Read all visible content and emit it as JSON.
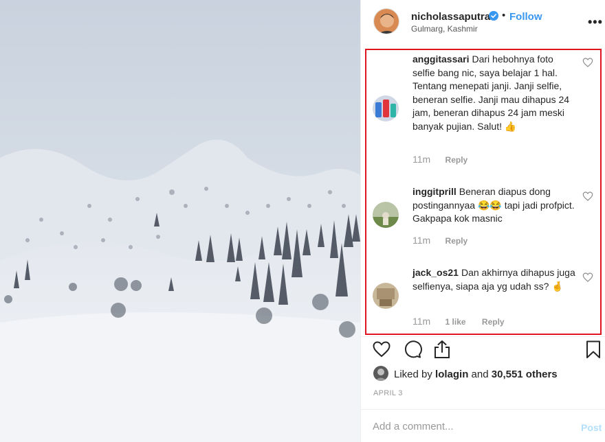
{
  "post": {
    "username": "nicholassaputra",
    "follow_label": "Follow",
    "dot": "•",
    "location": "Gulmarg, Kashmir",
    "more_label": "•••"
  },
  "comments": [
    {
      "username": "anggitassari",
      "text": "Dari hebohnya foto selfie bang nic, saya belajar 1 hal. Tentang menepati janji. Janji selfie, beneran selfie. Janji mau dihapus 24 jam, beneran dihapus 24 jam meski banyak pujian. Salut! 👍",
      "time": "11m",
      "likes": "",
      "reply_label": "Reply"
    },
    {
      "username": "inggitprill",
      "text": "Beneran diapus dong postingannyaa 😂😂 tapi jadi profpict. Gakpapa kok masnic",
      "time": "11m",
      "likes": "",
      "reply_label": "Reply"
    },
    {
      "username": "jack_os21",
      "text": "Dan akhirnya dihapus juga selfienya, siapa aja yg udah ss? 🤞",
      "time": "11m",
      "likes": "1 like",
      "reply_label": "Reply"
    }
  ],
  "likes": {
    "prefix": "Liked by ",
    "user": "lolagin",
    "middle": " and ",
    "count": "30,551 others"
  },
  "date": "APRIL 3",
  "add_comment": {
    "placeholder": "Add a comment...",
    "post_label": "Post"
  },
  "icons": {
    "verified": "verified-badge-icon",
    "heart": "heart-icon",
    "comment": "comment-icon",
    "share": "share-icon",
    "save": "bookmark-icon",
    "more": "more-options-icon"
  },
  "colors": {
    "accent": "#3897f0",
    "highlight_border": "#e0141e",
    "muted": "#999999"
  }
}
